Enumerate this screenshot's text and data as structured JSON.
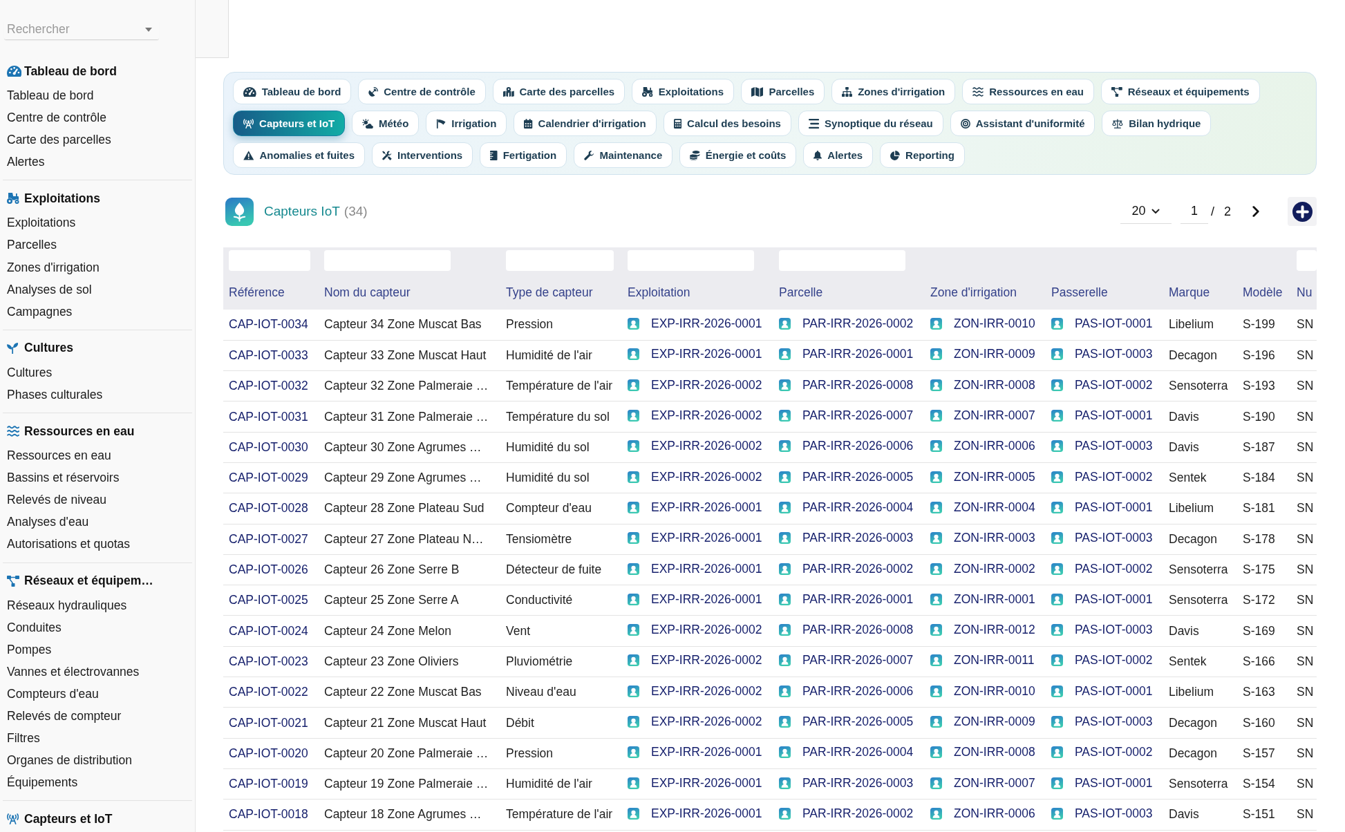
{
  "search": {
    "placeholder": "Rechercher"
  },
  "sidebar": {
    "sections": [
      {
        "title": "Tableau de bord",
        "items": [
          "Tableau de bord",
          "Centre de contrôle",
          "Carte des parcelles",
          "Alertes"
        ]
      },
      {
        "title": "Exploitations",
        "items": [
          "Exploitations",
          "Parcelles",
          "Zones d'irrigation",
          "Analyses de sol",
          "Campagnes"
        ]
      },
      {
        "title": "Cultures",
        "items": [
          "Cultures",
          "Phases culturales"
        ]
      },
      {
        "title": "Ressources en eau",
        "items": [
          "Ressources en eau",
          "Bassins et réservoirs",
          "Relevés de niveau",
          "Analyses d'eau",
          "Autorisations et quotas"
        ]
      },
      {
        "title": "Réseaux et équipem…",
        "items": [
          "Réseaux hydrauliques",
          "Conduites",
          "Pompes",
          "Vannes et électrovannes",
          "Compteurs d'eau",
          "Relevés de compteur",
          "Filtres",
          "Organes de distribution",
          "Équipements"
        ]
      },
      {
        "title": "Capteurs et IoT"
      }
    ]
  },
  "tabs": [
    {
      "label": "Tableau de bord",
      "selected": false
    },
    {
      "label": "Centre de contrôle",
      "selected": false
    },
    {
      "label": "Carte des parcelles",
      "selected": false
    },
    {
      "label": "Exploitations",
      "selected": false
    },
    {
      "label": "Parcelles",
      "selected": false
    },
    {
      "label": "Zones d'irrigation",
      "selected": false
    },
    {
      "label": "Ressources en eau",
      "selected": false
    },
    {
      "label": "Réseaux et équipements",
      "selected": false
    },
    {
      "label": "Capteurs et IoT",
      "selected": true
    },
    {
      "label": "Météo",
      "selected": false
    },
    {
      "label": "Irrigation",
      "selected": false
    },
    {
      "label": "Calendrier d'irrigation",
      "selected": false
    },
    {
      "label": "Calcul des besoins",
      "selected": false
    },
    {
      "label": "Synoptique du réseau",
      "selected": false
    },
    {
      "label": "Assistant d'uniformité",
      "selected": false
    },
    {
      "label": "Bilan hydrique",
      "selected": false
    },
    {
      "label": "Anomalies et fuites",
      "selected": false
    },
    {
      "label": "Interventions",
      "selected": false
    },
    {
      "label": "Fertigation",
      "selected": false
    },
    {
      "label": "Maintenance",
      "selected": false
    },
    {
      "label": "Énergie et coûts",
      "selected": false
    },
    {
      "label": "Alertes",
      "selected": false
    },
    {
      "label": "Reporting",
      "selected": false
    }
  ],
  "list_header": {
    "title": "Capteurs IoT",
    "count": "(34)",
    "page_size": "20",
    "page": "1",
    "separator": "/",
    "page_count": "2"
  },
  "table": {
    "columns": [
      {
        "label": "Référence",
        "kind": "link",
        "filter": true
      },
      {
        "label": "Nom du capteur",
        "kind": "text",
        "filter": true
      },
      {
        "label": "Type de capteur",
        "kind": "text",
        "filter": true
      },
      {
        "label": "Exploitation",
        "kind": "relation",
        "filter": true
      },
      {
        "label": "Parcelle",
        "kind": "relation",
        "filter": true
      },
      {
        "label": "Zone d'irrigation",
        "kind": "relation",
        "filter": false
      },
      {
        "label": "Passerelle",
        "kind": "relation",
        "filter": false
      },
      {
        "label": "Marque",
        "kind": "text",
        "filter": false
      },
      {
        "label": "Modèle",
        "kind": "text",
        "filter": false
      },
      {
        "label": "Nu",
        "kind": "text",
        "filter": true
      }
    ],
    "rows": [
      [
        "CAP-IOT-0034",
        "Capteur 34 Zone Muscat Bas",
        "Pression",
        "EXP-IRR-2026-0001",
        "PAR-IRR-2026-0002",
        "ZON-IRR-0010",
        "PAS-IOT-0001",
        "Libelium",
        "S-199",
        "SN"
      ],
      [
        "CAP-IOT-0033",
        "Capteur 33 Zone Muscat Haut",
        "Humidité de l'air",
        "EXP-IRR-2026-0001",
        "PAR-IRR-2026-0001",
        "ZON-IRR-0009",
        "PAS-IOT-0003",
        "Decagon",
        "S-196",
        "SN"
      ],
      [
        "CAP-IOT-0032",
        "Capteur 32 Zone Palmeraie …",
        "Température de l'air",
        "EXP-IRR-2026-0002",
        "PAR-IRR-2026-0008",
        "ZON-IRR-0008",
        "PAS-IOT-0002",
        "Sensoterra",
        "S-193",
        "SN"
      ],
      [
        "CAP-IOT-0031",
        "Capteur 31 Zone Palmeraie …",
        "Température du sol",
        "EXP-IRR-2026-0002",
        "PAR-IRR-2026-0007",
        "ZON-IRR-0007",
        "PAS-IOT-0001",
        "Davis",
        "S-190",
        "SN"
      ],
      [
        "CAP-IOT-0030",
        "Capteur 30 Zone Agrumes …",
        "Humidité du sol",
        "EXP-IRR-2026-0002",
        "PAR-IRR-2026-0006",
        "ZON-IRR-0006",
        "PAS-IOT-0003",
        "Davis",
        "S-187",
        "SN"
      ],
      [
        "CAP-IOT-0029",
        "Capteur 29 Zone Agrumes …",
        "Humidité du sol",
        "EXP-IRR-2026-0002",
        "PAR-IRR-2026-0005",
        "ZON-IRR-0005",
        "PAS-IOT-0002",
        "Sentek",
        "S-184",
        "SN"
      ],
      [
        "CAP-IOT-0028",
        "Capteur 28 Zone Plateau Sud",
        "Compteur d'eau",
        "EXP-IRR-2026-0001",
        "PAR-IRR-2026-0004",
        "ZON-IRR-0004",
        "PAS-IOT-0001",
        "Libelium",
        "S-181",
        "SN"
      ],
      [
        "CAP-IOT-0027",
        "Capteur 27 Zone Plateau N…",
        "Tensiomètre",
        "EXP-IRR-2026-0001",
        "PAR-IRR-2026-0003",
        "ZON-IRR-0003",
        "PAS-IOT-0003",
        "Decagon",
        "S-178",
        "SN"
      ],
      [
        "CAP-IOT-0026",
        "Capteur 26 Zone Serre B",
        "Détecteur de fuite",
        "EXP-IRR-2026-0001",
        "PAR-IRR-2026-0002",
        "ZON-IRR-0002",
        "PAS-IOT-0002",
        "Sensoterra",
        "S-175",
        "SN"
      ],
      [
        "CAP-IOT-0025",
        "Capteur 25 Zone Serre A",
        "Conductivité",
        "EXP-IRR-2026-0001",
        "PAR-IRR-2026-0001",
        "ZON-IRR-0001",
        "PAS-IOT-0001",
        "Sensoterra",
        "S-172",
        "SN"
      ],
      [
        "CAP-IOT-0024",
        "Capteur 24 Zone Melon",
        "Vent",
        "EXP-IRR-2026-0002",
        "PAR-IRR-2026-0008",
        "ZON-IRR-0012",
        "PAS-IOT-0003",
        "Davis",
        "S-169",
        "SN"
      ],
      [
        "CAP-IOT-0023",
        "Capteur 23 Zone Oliviers",
        "Pluviométrie",
        "EXP-IRR-2026-0002",
        "PAR-IRR-2026-0007",
        "ZON-IRR-0011",
        "PAS-IOT-0002",
        "Sentek",
        "S-166",
        "SN"
      ],
      [
        "CAP-IOT-0022",
        "Capteur 22 Zone Muscat Bas",
        "Niveau d'eau",
        "EXP-IRR-2026-0002",
        "PAR-IRR-2026-0006",
        "ZON-IRR-0010",
        "PAS-IOT-0001",
        "Libelium",
        "S-163",
        "SN"
      ],
      [
        "CAP-IOT-0021",
        "Capteur 21 Zone Muscat Haut",
        "Débit",
        "EXP-IRR-2026-0002",
        "PAR-IRR-2026-0005",
        "ZON-IRR-0009",
        "PAS-IOT-0003",
        "Decagon",
        "S-160",
        "SN"
      ],
      [
        "CAP-IOT-0020",
        "Capteur 20 Zone Palmeraie …",
        "Pression",
        "EXP-IRR-2026-0001",
        "PAR-IRR-2026-0004",
        "ZON-IRR-0008",
        "PAS-IOT-0002",
        "Decagon",
        "S-157",
        "SN"
      ],
      [
        "CAP-IOT-0019",
        "Capteur 19 Zone Palmeraie …",
        "Humidité de l'air",
        "EXP-IRR-2026-0001",
        "PAR-IRR-2026-0003",
        "ZON-IRR-0007",
        "PAS-IOT-0001",
        "Sensoterra",
        "S-154",
        "SN"
      ],
      [
        "CAP-IOT-0018",
        "Capteur 18 Zone Agrumes …",
        "Température de l'air",
        "EXP-IRR-2026-0001",
        "PAR-IRR-2026-0002",
        "ZON-IRR-0006",
        "PAS-IOT-0003",
        "Davis",
        "S-151",
        "SN"
      ]
    ]
  }
}
